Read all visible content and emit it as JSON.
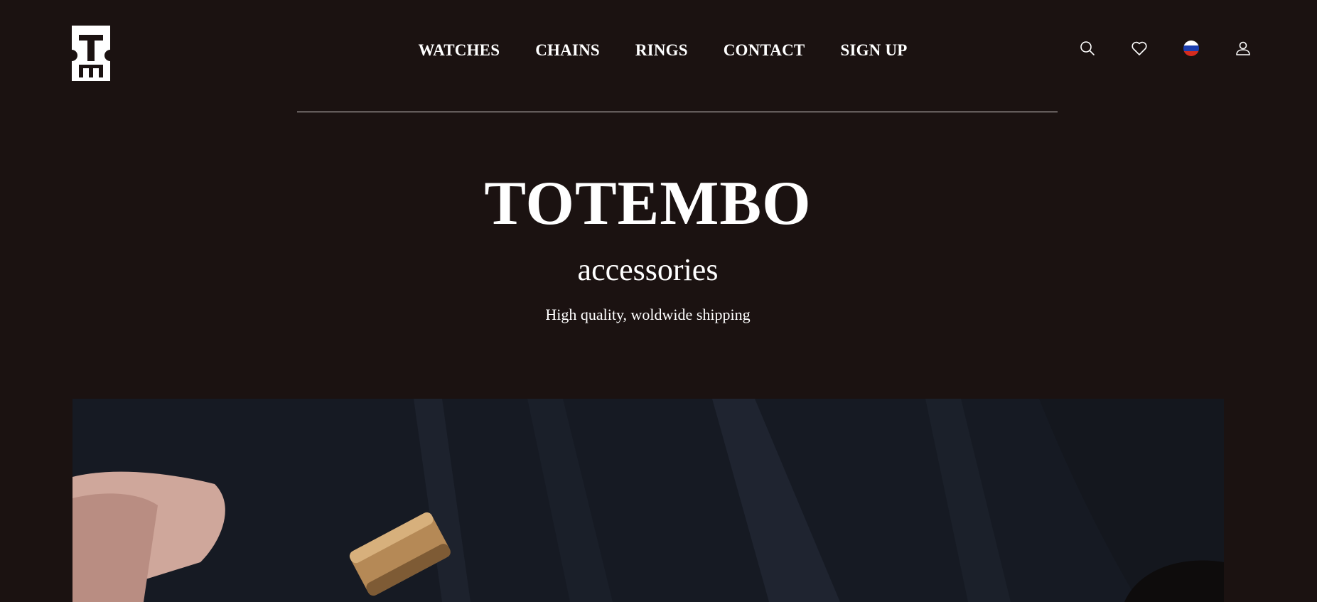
{
  "brand": {
    "logo_icon": "totembo-logo-icon"
  },
  "nav": {
    "items": [
      {
        "label": "WATCHES"
      },
      {
        "label": "CHAINS"
      },
      {
        "label": "RINGS"
      },
      {
        "label": "CONTACT"
      },
      {
        "label": "SIGN UP"
      }
    ]
  },
  "header_icons": [
    "search-icon",
    "heart-icon",
    "russia-flag-icon",
    "user-icon"
  ],
  "hero": {
    "title": "TOTEMBO",
    "subtitle": "accessories",
    "tagline": "High quality, woldwide shipping"
  },
  "colors": {
    "background": "#1b1211",
    "text": "#ffffff",
    "divider": "#d9d4d2"
  }
}
